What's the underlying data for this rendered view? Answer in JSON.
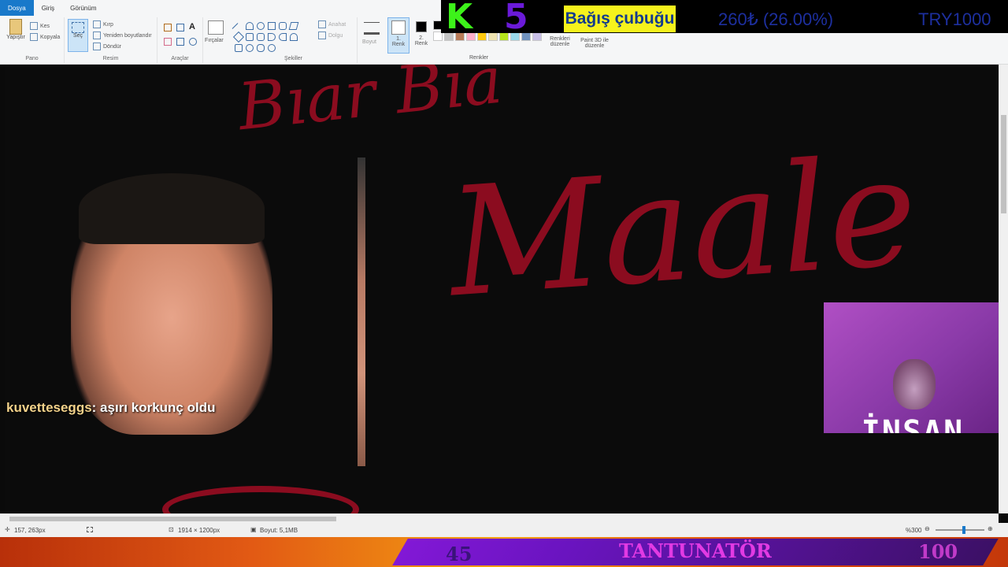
{
  "ribbon": {
    "tabs": [
      "Dosya",
      "Giriş",
      "Görünüm"
    ],
    "pano": {
      "paste": "Yapıştır",
      "cut": "Kes",
      "copy": "Kopyala",
      "label": "Pano"
    },
    "resim": {
      "select": "Seç",
      "crop": "Kırp",
      "resize": "Yeniden boyutlandır",
      "rotate": "Döndür",
      "label": "Resim"
    },
    "araclar": {
      "label": "Araçlar"
    },
    "fircalar": "Fırçalar",
    "sekiller": {
      "outline": "Anahat",
      "fill": "Dolgu",
      "label": "Şekiller"
    },
    "boyut": "Boyut",
    "renk1": {
      "num": "1.",
      "label": "Renk"
    },
    "renk2": {
      "num": "2.",
      "label": "Renk"
    },
    "renkler": {
      "edit": "Renkleri düzenle",
      "paint3d": "Paint 3D ile düzenle",
      "label": "Renkler"
    }
  },
  "overlay": {
    "k_letter": "K",
    "five": "5",
    "donation_button": "Bağış çubuğu",
    "raised": "260₺ (26.00%)",
    "goal": "TRY1000"
  },
  "canvas_text": {
    "line1": "Bıar Bıa",
    "line2": "Maale"
  },
  "chat": {
    "user": "kuvetteseggs",
    "message": ": aşırı korkunç oldu"
  },
  "webcam": {
    "label": "İNSAN"
  },
  "status": {
    "cursor": "157, 263px",
    "dimensions": "1914 × 1200px",
    "size": "Boyut: 5,1MB",
    "zoom": "%300"
  },
  "bottom_bar": {
    "left_num": "45",
    "title": "TANTUNATÖR",
    "right_num": "100"
  },
  "colors": {
    "palette_row1": [
      "#000000",
      "#7f7f7f",
      "#880015",
      "#ed1c24",
      "#ff7f27",
      "#fff200",
      "#22b14c",
      "#00a2e8",
      "#3f48cc",
      "#a349a4"
    ],
    "palette_row2": [
      "#ffffff",
      "#c3c3c3",
      "#b97a57",
      "#ffaec9",
      "#ffc90e",
      "#efe4b0",
      "#b5e61d",
      "#99d9ea",
      "#7092be",
      "#c8bfe7"
    ]
  }
}
